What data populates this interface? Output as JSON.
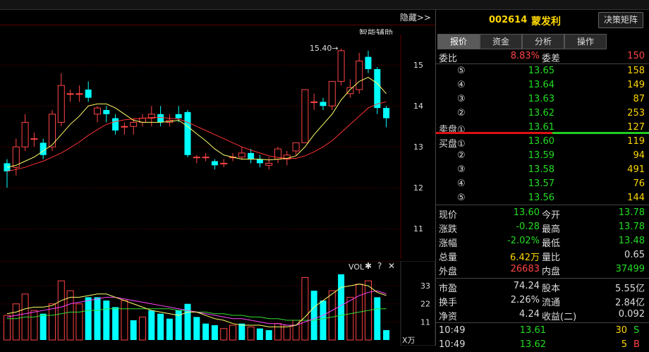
{
  "toolbar": {
    "hide_label": "隐藏>>",
    "smart_assist": "智能辅助"
  },
  "colors": {
    "up": "#ff4444",
    "down": "#22dd22",
    "candle_down": "#00ffff",
    "ma5": "#ffff66",
    "ma10": "#ff3333",
    "vol_ma5": "#ffff66",
    "vol_ma10": "#ff44ff",
    "vol_ma20": "#33dd33"
  },
  "kline": {
    "y_ticks": [
      "15",
      "14",
      "13",
      "12",
      "11"
    ],
    "max_marker": "15.40→",
    "candles": [
      {
        "o": 12.6,
        "c": 12.4,
        "h": 12.7,
        "l": 12.0
      },
      {
        "o": 12.5,
        "c": 13.0,
        "h": 13.2,
        "l": 12.3
      },
      {
        "o": 13.0,
        "c": 13.6,
        "h": 13.8,
        "l": 12.9
      },
      {
        "o": 13.2,
        "c": 13.2,
        "h": 13.35,
        "l": 13.0
      },
      {
        "o": 13.1,
        "c": 12.8,
        "h": 13.2,
        "l": 12.7
      },
      {
        "o": 13.0,
        "c": 13.8,
        "h": 13.9,
        "l": 12.9
      },
      {
        "o": 13.6,
        "c": 14.5,
        "h": 14.8,
        "l": 13.5
      },
      {
        "o": 14.3,
        "c": 14.3,
        "h": 14.4,
        "l": 14.1
      },
      {
        "o": 14.3,
        "c": 14.3,
        "h": 14.5,
        "l": 14.1
      },
      {
        "o": 14.4,
        "c": 14.2,
        "h": 14.6,
        "l": 14.1
      },
      {
        "o": 13.8,
        "c": 13.95,
        "h": 14.0,
        "l": 13.6
      },
      {
        "o": 13.9,
        "c": 13.8,
        "h": 14.0,
        "l": 13.6
      },
      {
        "o": 13.7,
        "c": 13.4,
        "h": 13.8,
        "l": 13.3
      },
      {
        "o": 13.5,
        "c": 13.5,
        "h": 13.6,
        "l": 13.3
      },
      {
        "o": 13.5,
        "c": 13.6,
        "h": 13.7,
        "l": 13.3
      },
      {
        "o": 13.6,
        "c": 13.7,
        "h": 13.8,
        "l": 13.5
      },
      {
        "o": 13.7,
        "c": 13.8,
        "h": 14.0,
        "l": 13.5
      },
      {
        "o": 13.8,
        "c": 13.6,
        "h": 14.0,
        "l": 13.5
      },
      {
        "o": 13.6,
        "c": 13.65,
        "h": 13.8,
        "l": 13.5
      },
      {
        "o": 13.8,
        "c": 13.7,
        "h": 14.0,
        "l": 13.6
      },
      {
        "o": 13.85,
        "c": 12.8,
        "h": 13.9,
        "l": 12.75
      },
      {
        "o": 12.75,
        "c": 12.75,
        "h": 12.8,
        "l": 12.6
      },
      {
        "o": 12.75,
        "c": 12.75,
        "h": 12.85,
        "l": 12.65
      },
      {
        "o": 12.65,
        "c": 12.55,
        "h": 12.7,
        "l": 12.45
      },
      {
        "o": 12.6,
        "c": 12.6,
        "h": 12.7,
        "l": 12.5
      },
      {
        "o": 12.75,
        "c": 12.75,
        "h": 12.85,
        "l": 12.65
      },
      {
        "o": 12.75,
        "c": 12.85,
        "h": 13.0,
        "l": 12.7
      },
      {
        "o": 12.85,
        "c": 12.7,
        "h": 12.95,
        "l": 12.6
      },
      {
        "o": 12.7,
        "c": 12.6,
        "h": 12.8,
        "l": 12.5
      },
      {
        "o": 12.55,
        "c": 12.6,
        "h": 12.75,
        "l": 12.45
      },
      {
        "o": 12.7,
        "c": 12.95,
        "h": 13.0,
        "l": 12.6
      },
      {
        "o": 12.7,
        "c": 12.8,
        "h": 12.9,
        "l": 12.55
      },
      {
        "o": 12.9,
        "c": 13.1,
        "h": 13.1,
        "l": 12.8
      },
      {
        "o": 13.1,
        "c": 14.4,
        "h": 14.4,
        "l": 13.1
      },
      {
        "o": 14.1,
        "c": 14.1,
        "h": 14.3,
        "l": 13.9
      },
      {
        "o": 14.1,
        "c": 14.0,
        "h": 14.2,
        "l": 13.9
      },
      {
        "o": 14.0,
        "c": 14.6,
        "h": 14.6,
        "l": 13.9
      },
      {
        "o": 14.6,
        "c": 15.35,
        "h": 15.4,
        "l": 14.5
      },
      {
        "o": 14.3,
        "c": 14.45,
        "h": 14.65,
        "l": 14.2
      },
      {
        "o": 14.4,
        "c": 15.1,
        "h": 15.3,
        "l": 14.3
      },
      {
        "o": 15.2,
        "c": 14.9,
        "h": 15.35,
        "l": 14.8
      },
      {
        "o": 14.9,
        "c": 13.95,
        "h": 14.95,
        "l": 13.8
      },
      {
        "o": 13.95,
        "c": 13.7,
        "h": 14.0,
        "l": 13.48
      }
    ],
    "ma5": [
      12.5,
      12.55,
      12.65,
      12.75,
      12.9,
      13.05,
      13.3,
      13.55,
      13.75,
      14.0,
      14.05,
      14.05,
      13.95,
      13.8,
      13.65,
      13.6,
      13.6,
      13.6,
      13.62,
      13.65,
      13.5,
      13.32,
      13.15,
      12.95,
      12.8,
      12.75,
      12.7,
      12.7,
      12.7,
      12.68,
      12.7,
      12.72,
      12.78,
      13.0,
      13.3,
      13.55,
      13.8,
      14.15,
      14.4,
      14.6,
      14.7,
      14.55,
      14.3
    ],
    "ma10": [
      12.4,
      12.45,
      12.5,
      12.58,
      12.65,
      12.75,
      12.85,
      12.98,
      13.12,
      13.28,
      13.42,
      13.55,
      13.62,
      13.66,
      13.68,
      13.7,
      13.72,
      13.72,
      13.7,
      13.68,
      13.6,
      13.5,
      13.4,
      13.3,
      13.2,
      13.1,
      13.0,
      12.92,
      12.85,
      12.78,
      12.74,
      12.72,
      12.72,
      12.78,
      12.88,
      13.0,
      13.15,
      13.35,
      13.55,
      13.75,
      13.95,
      14.05,
      14.1
    ]
  },
  "volume": {
    "header": "VOL",
    "unit_label": "X万",
    "y_ticks": [
      "33",
      "22",
      "11"
    ],
    "bars": [
      {
        "v": 15,
        "up": true
      },
      {
        "v": 22,
        "up": true
      },
      {
        "v": 28,
        "up": true
      },
      {
        "v": 18,
        "up": true
      },
      {
        "v": 16,
        "up": false
      },
      {
        "v": 22,
        "up": true
      },
      {
        "v": 36,
        "up": true
      },
      {
        "v": 30,
        "up": true
      },
      {
        "v": 22,
        "up": true
      },
      {
        "v": 26,
        "up": false
      },
      {
        "v": 26,
        "up": false
      },
      {
        "v": 24,
        "up": false
      },
      {
        "v": 20,
        "up": false
      },
      {
        "v": 24,
        "up": true
      },
      {
        "v": 12,
        "up": false
      },
      {
        "v": 14,
        "up": true
      },
      {
        "v": 18,
        "up": false
      },
      {
        "v": 16,
        "up": false
      },
      {
        "v": 13,
        "up": false
      },
      {
        "v": 18,
        "up": false
      },
      {
        "v": 22,
        "up": false
      },
      {
        "v": 14,
        "up": false
      },
      {
        "v": 10,
        "up": false
      },
      {
        "v": 9,
        "up": false
      },
      {
        "v": 7,
        "up": true
      },
      {
        "v": 9,
        "up": true
      },
      {
        "v": 10,
        "up": false
      },
      {
        "v": 8,
        "up": true
      },
      {
        "v": 7,
        "up": false
      },
      {
        "v": 6,
        "up": false
      },
      {
        "v": 10,
        "up": true
      },
      {
        "v": 9,
        "up": true
      },
      {
        "v": 12,
        "up": true
      },
      {
        "v": 38,
        "up": true
      },
      {
        "v": 30,
        "up": false
      },
      {
        "v": 24,
        "up": false
      },
      {
        "v": 30,
        "up": true
      },
      {
        "v": 40,
        "up": false
      },
      {
        "v": 26,
        "up": true
      },
      {
        "v": 34,
        "up": true
      },
      {
        "v": 36,
        "up": true
      },
      {
        "v": 26,
        "up": false
      },
      {
        "v": 6,
        "up": false
      }
    ],
    "ma5": [
      16,
      17,
      19,
      20,
      20,
      21,
      24,
      26,
      26,
      27,
      28,
      28,
      26,
      24,
      22,
      20,
      18,
      17,
      16,
      15,
      17,
      17,
      15,
      13,
      12,
      10,
      9,
      9,
      9,
      8,
      8,
      8,
      9,
      14,
      20,
      24,
      28,
      32,
      33,
      34,
      33,
      29,
      27
    ],
    "ma10": [
      14,
      15,
      16,
      17,
      18,
      19,
      20,
      22,
      23,
      24,
      25,
      26,
      26,
      25,
      24,
      23,
      22,
      21,
      20,
      19,
      18,
      17,
      16,
      15,
      14,
      13,
      13,
      12,
      11,
      10,
      10,
      9,
      9,
      11,
      13,
      15,
      18,
      21,
      24,
      27,
      29,
      30,
      28
    ],
    "ma20": [
      13,
      13,
      14,
      14,
      15,
      15,
      16,
      17,
      17,
      18,
      18,
      19,
      19,
      19,
      19,
      19,
      19,
      19,
      19,
      18,
      18,
      17,
      17,
      16,
      16,
      15,
      15,
      14,
      14,
      13,
      13,
      12,
      12,
      12,
      12,
      13,
      14,
      15,
      16,
      17,
      18,
      19,
      19
    ]
  },
  "quote": {
    "code": "002614",
    "name": "蒙发利",
    "decision_button": "决策矩阵",
    "tabs": [
      "报价",
      "资金",
      "分析",
      "操作"
    ],
    "webi_label": "委比",
    "webi_value": "8.83%",
    "weicha_label": "委差",
    "weicha_value": "150",
    "sell": [
      {
        "label": "⑤",
        "price": "13.65",
        "vol": "158"
      },
      {
        "label": "④",
        "price": "13.64",
        "vol": "149"
      },
      {
        "label": "③",
        "price": "13.63",
        "vol": "87"
      },
      {
        "label": "②",
        "price": "13.62",
        "vol": "253"
      },
      {
        "label": "卖盘①",
        "price": "13.61",
        "vol": "127"
      }
    ],
    "buy": [
      {
        "label": "买盘①",
        "price": "13.60",
        "vol": "119"
      },
      {
        "label": "②",
        "price": "13.59",
        "vol": "94"
      },
      {
        "label": "③",
        "price": "13.58",
        "vol": "491"
      },
      {
        "label": "④",
        "price": "13.57",
        "vol": "76"
      },
      {
        "label": "⑤",
        "price": "13.56",
        "vol": "144"
      }
    ],
    "stats": [
      {
        "l1": "现价",
        "v1": "13.60",
        "c1": "green",
        "l2": "今开",
        "v2": "13.78",
        "c2": "green"
      },
      {
        "l1": "涨跌",
        "v1": "-0.28",
        "c1": "green",
        "l2": "最高",
        "v2": "13.78",
        "c2": "green"
      },
      {
        "l1": "涨幅",
        "v1": "-2.02%",
        "c1": "green",
        "l2": "最低",
        "v2": "13.48",
        "c2": "green"
      },
      {
        "l1": "总量",
        "v1": "6.42万",
        "c1": "yellow",
        "l2": "量比",
        "v2": "0.65",
        "c2": "white"
      },
      {
        "l1": "外盘",
        "v1": "26683",
        "c1": "red",
        "l2": "内盘",
        "v2": "37499",
        "c2": "green"
      }
    ],
    "fund": [
      {
        "l1": "市盈",
        "v1": "74.24",
        "l2": "股本",
        "v2": "5.55亿"
      },
      {
        "l1": "换手",
        "v1": "2.26%",
        "l2": "流通",
        "v2": "2.84亿"
      },
      {
        "l1": "净资",
        "v1": "4.24",
        "l2": "收益(二)",
        "v2": "0.092"
      }
    ],
    "ticks": [
      {
        "time": "10:49",
        "price": "13.61",
        "vol": "30",
        "side": "S",
        "color": "green"
      },
      {
        "time": "10:49",
        "price": "13.62",
        "vol": "5",
        "side": "B",
        "color": "red"
      }
    ]
  }
}
